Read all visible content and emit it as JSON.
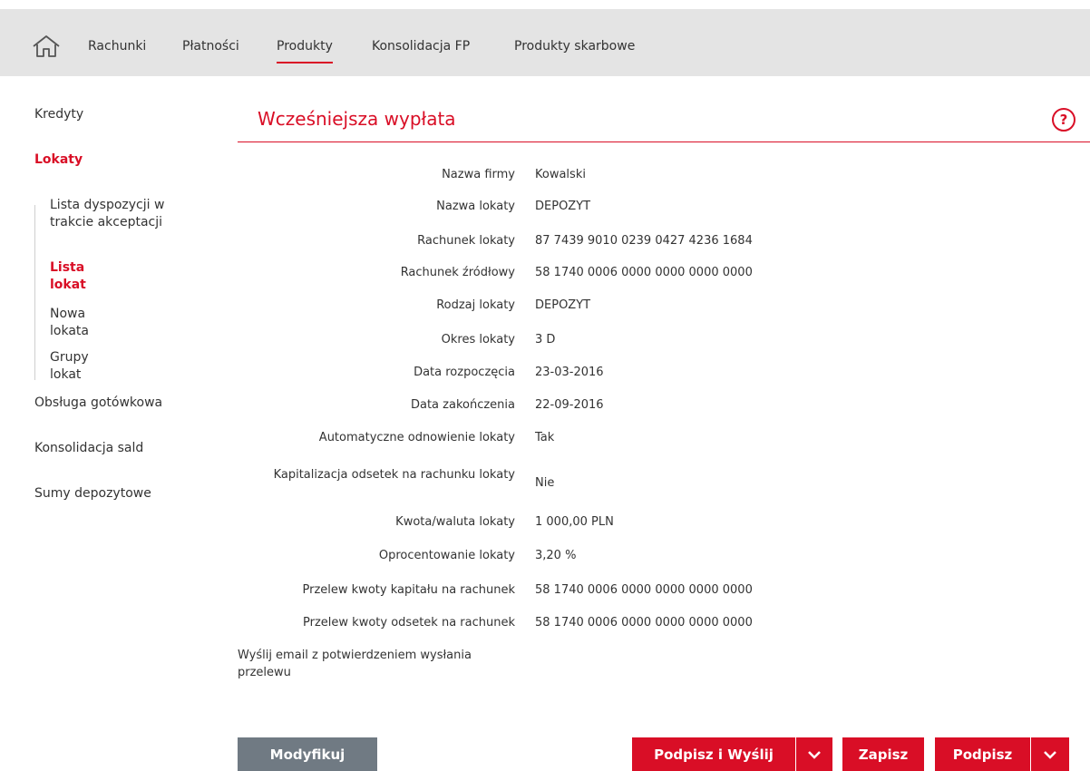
{
  "colors": {
    "accent": "#d90e26",
    "topbar": "#e4e4e4",
    "button_grey": "#707a83"
  },
  "topnav": {
    "home_icon": "home-icon",
    "items": [
      {
        "label": "Rachunki"
      },
      {
        "label": "Płatności"
      },
      {
        "label": "Produkty",
        "active": true
      },
      {
        "label": "Konsolidacja FP"
      },
      {
        "label": "Produkty skarbowe"
      }
    ]
  },
  "sidebar": {
    "items": [
      {
        "label": "Kredyty"
      },
      {
        "label": "Lokaty",
        "active": true
      },
      {
        "label": "Obsługa gotówkowa"
      },
      {
        "label": "Konsolidacja sald"
      },
      {
        "label": "Sumy depozytowe"
      }
    ],
    "subitems": [
      {
        "label": "Lista dyspozycji w trakcie akceptacji"
      },
      {
        "label": "Lista lokat",
        "active": true
      },
      {
        "label": "Nowa lokata"
      },
      {
        "label": "Grupy lokat"
      }
    ]
  },
  "page": {
    "title": "Wcześniejsza wypłata",
    "help_icon": "help-icon"
  },
  "details": [
    {
      "label": "Nazwa firmy",
      "value": "Kowalski"
    },
    {
      "label": "Nazwa lokaty",
      "value": "DEPOZYT"
    },
    {
      "label": "Rachunek lokaty",
      "value": "87 7439 9010 0239 0427 4236 1684"
    },
    {
      "label": "Rachunek źródłowy",
      "value": "58 1740 0006 0000 0000 0000 0000"
    },
    {
      "label": "Rodzaj lokaty",
      "value": "DEPOZYT"
    },
    {
      "label": "Okres lokaty",
      "value": "3 D"
    },
    {
      "label": "Data rozpoczęcia",
      "value": "23-03-2016"
    },
    {
      "label": "Data zakończenia",
      "value": "22-09-2016"
    },
    {
      "label": "Automatyczne odnowienie lokaty",
      "value": "Tak"
    },
    {
      "label": "Kapitalizacja odsetek na rachunku lokaty",
      "value": "Nie"
    },
    {
      "label": "Kwota/waluta lokaty",
      "value": "1 000,00 PLN"
    },
    {
      "label": "Oprocentowanie lokaty",
      "value": "3,20 %"
    },
    {
      "label": "Przelew kwoty kapitału na rachunek",
      "value": "58 1740 0006 0000 0000 0000 0000"
    },
    {
      "label": "Przelew kwoty odsetek na rachunek",
      "value": "58 1740 0006 0000 0000 0000 0000"
    }
  ],
  "email_label": "Wyślij email z potwierdzeniem wysłania przelewu",
  "buttons": {
    "modify": "Modyfikuj",
    "sign_send": "Podpisz i Wyślij",
    "save": "Zapisz",
    "sign": "Podpisz"
  }
}
